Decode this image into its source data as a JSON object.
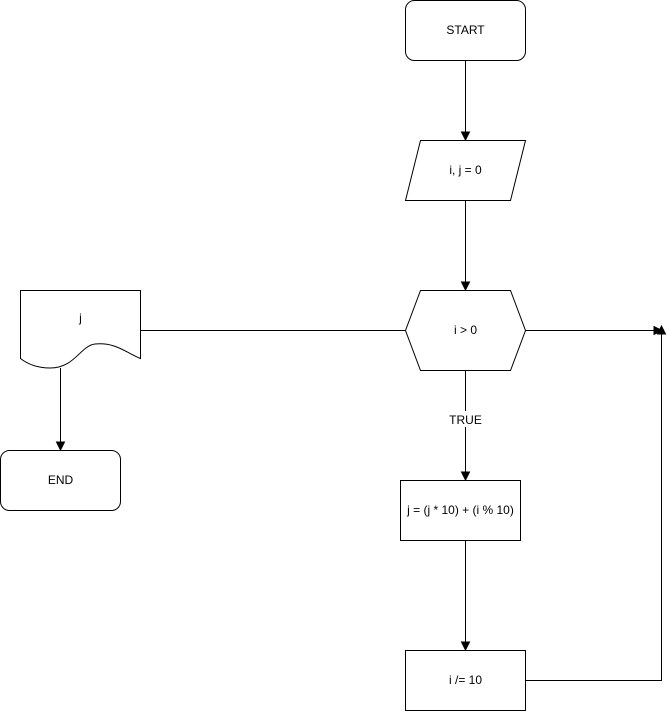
{
  "nodes": {
    "start": {
      "label": "START",
      "shape": "terminator"
    },
    "init": {
      "label": "i, j = 0",
      "shape": "data-parallelogram"
    },
    "condition": {
      "label": "i > 0",
      "shape": "preparation-hexagon"
    },
    "compute": {
      "label": "j = (j * 10) + (i % 10)",
      "shape": "process"
    },
    "divide": {
      "label": "i /= 10",
      "shape": "process"
    },
    "output": {
      "label": "j",
      "shape": "document"
    },
    "end": {
      "label": "END",
      "shape": "terminator"
    }
  },
  "edges": {
    "true_label": "TRUE"
  },
  "colors": {
    "stroke": "#000000",
    "fill": "#ffffff",
    "text": "#000000"
  }
}
